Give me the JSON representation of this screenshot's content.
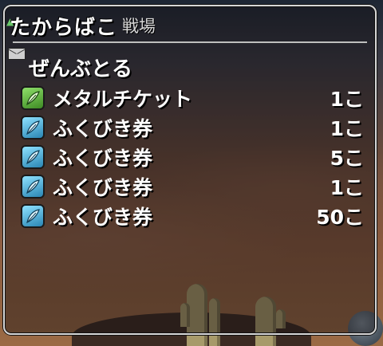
{
  "window": {
    "title": "たからばこ",
    "subtitle": "戦場",
    "take_all": "ぜんぶとる"
  },
  "items": [
    {
      "name": "メタルチケット",
      "count": "1こ",
      "icon": "green-feather-ticket-icon",
      "color": "#5fb23a"
    },
    {
      "name": "ふくびき券",
      "count": "1こ",
      "icon": "blue-feather-ticket-icon",
      "color": "#3fb0d8"
    },
    {
      "name": "ふくびき券",
      "count": "5こ",
      "icon": "blue-feather-ticket-icon",
      "color": "#3fb0d8"
    },
    {
      "name": "ふくびき券",
      "count": "1こ",
      "icon": "blue-feather-ticket-icon",
      "color": "#3fb0d8"
    },
    {
      "name": "ふくびき券",
      "count": "50こ",
      "icon": "blue-feather-ticket-icon",
      "color": "#3fb0d8"
    }
  ],
  "colors": {
    "window_border": "#d6d6d6",
    "text": "#ffffff",
    "green_icon": "#5fb23a",
    "blue_icon": "#3fb0d8"
  }
}
